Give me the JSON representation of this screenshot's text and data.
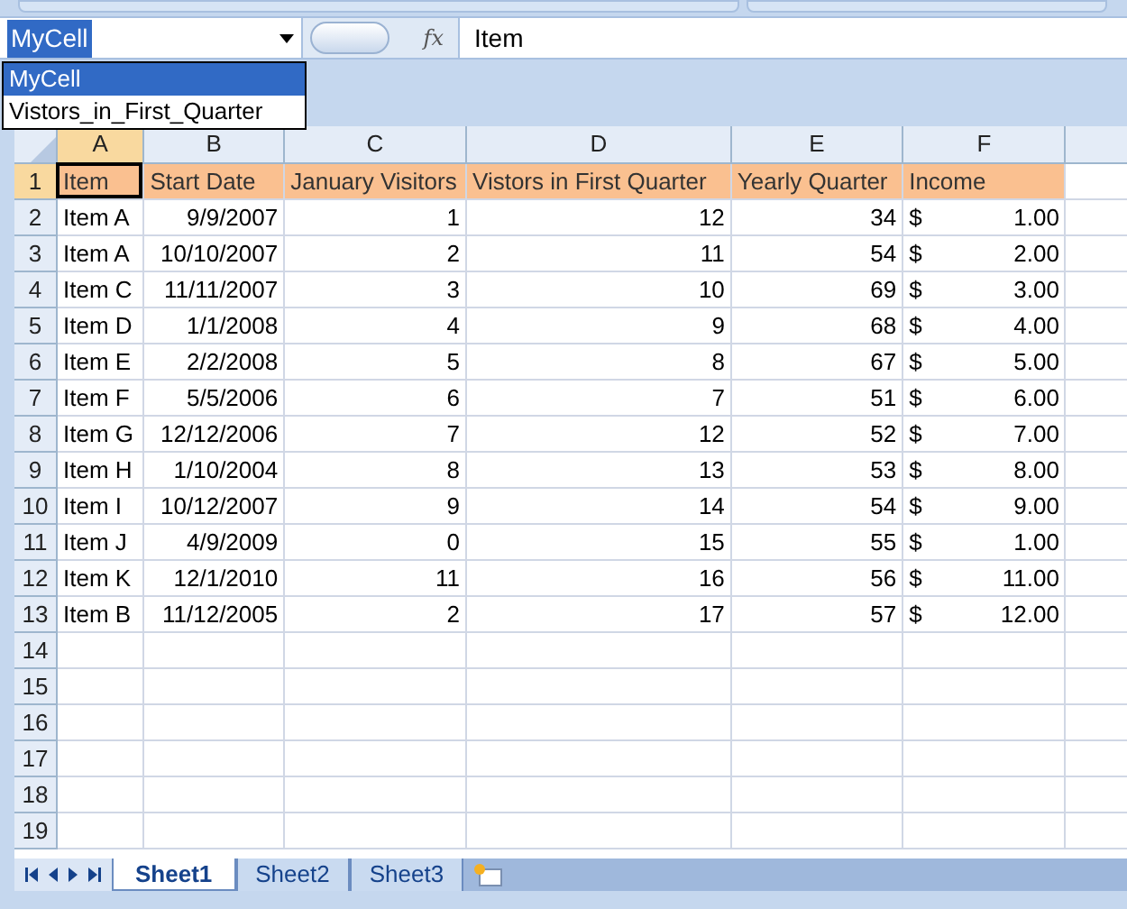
{
  "name_box": {
    "value": "MyCell"
  },
  "name_list": [
    {
      "label": "MyCell",
      "selected": true
    },
    {
      "label": "Vistors_in_First_Quarter",
      "selected": false
    }
  ],
  "formula_bar": {
    "function_label": "fx",
    "value": "Item"
  },
  "columns": [
    {
      "letter": "A",
      "kind": "text",
      "selected": true
    },
    {
      "letter": "B",
      "kind": "date",
      "selected": false
    },
    {
      "letter": "C",
      "kind": "number",
      "selected": false
    },
    {
      "letter": "D",
      "kind": "number",
      "selected": false
    },
    {
      "letter": "E",
      "kind": "number",
      "selected": false
    },
    {
      "letter": "F",
      "kind": "currency",
      "selected": false
    }
  ],
  "rows": [
    {
      "number": "1",
      "selected": true,
      "kind": "header",
      "cells": [
        "Item",
        "Start Date",
        "January Visitors",
        "Vistors in First Quarter",
        "Yearly Quarter",
        "Income"
      ]
    },
    {
      "number": "2",
      "selected": false,
      "kind": "data",
      "cells": [
        "Item A",
        "9/9/2007",
        "1",
        "12",
        "34",
        [
          "$",
          "1.00"
        ]
      ]
    },
    {
      "number": "3",
      "selected": false,
      "kind": "data",
      "cells": [
        "Item A",
        "10/10/2007",
        "2",
        "11",
        "54",
        [
          "$",
          "2.00"
        ]
      ]
    },
    {
      "number": "4",
      "selected": false,
      "kind": "data",
      "cells": [
        "Item C",
        "11/11/2007",
        "3",
        "10",
        "69",
        [
          "$",
          "3.00"
        ]
      ]
    },
    {
      "number": "5",
      "selected": false,
      "kind": "data",
      "cells": [
        "Item D",
        "1/1/2008",
        "4",
        "9",
        "68",
        [
          "$",
          "4.00"
        ]
      ]
    },
    {
      "number": "6",
      "selected": false,
      "kind": "data",
      "cells": [
        "Item E",
        "2/2/2008",
        "5",
        "8",
        "67",
        [
          "$",
          "5.00"
        ]
      ]
    },
    {
      "number": "7",
      "selected": false,
      "kind": "data",
      "cells": [
        "Item F",
        "5/5/2006",
        "6",
        "7",
        "51",
        [
          "$",
          "6.00"
        ]
      ]
    },
    {
      "number": "8",
      "selected": false,
      "kind": "data",
      "cells": [
        "Item G",
        "12/12/2006",
        "7",
        "12",
        "52",
        [
          "$",
          "7.00"
        ]
      ]
    },
    {
      "number": "9",
      "selected": false,
      "kind": "data",
      "cells": [
        "Item H",
        "1/10/2004",
        "8",
        "13",
        "53",
        [
          "$",
          "8.00"
        ]
      ]
    },
    {
      "number": "10",
      "selected": false,
      "kind": "data",
      "cells": [
        "Item I",
        "10/12/2007",
        "9",
        "14",
        "54",
        [
          "$",
          "9.00"
        ]
      ]
    },
    {
      "number": "11",
      "selected": false,
      "kind": "data",
      "cells": [
        "Item J",
        "4/9/2009",
        "0",
        "15",
        "55",
        [
          "$",
          "1.00"
        ]
      ]
    },
    {
      "number": "12",
      "selected": false,
      "kind": "data",
      "cells": [
        "Item K",
        "12/1/2010",
        "11",
        "16",
        "56",
        [
          "$",
          "11.00"
        ]
      ]
    },
    {
      "number": "13",
      "selected": false,
      "kind": "data",
      "cells": [
        "Item B",
        "11/12/2005",
        "2",
        "17",
        "57",
        [
          "$",
          "12.00"
        ]
      ]
    },
    {
      "number": "14",
      "selected": false,
      "kind": "empty",
      "cells": []
    },
    {
      "number": "15",
      "selected": false,
      "kind": "empty",
      "cells": []
    },
    {
      "number": "16",
      "selected": false,
      "kind": "empty",
      "cells": []
    },
    {
      "number": "17",
      "selected": false,
      "kind": "empty",
      "cells": []
    },
    {
      "number": "18",
      "selected": false,
      "kind": "empty",
      "cells": []
    },
    {
      "number": "19",
      "selected": false,
      "kind": "empty",
      "cells": []
    }
  ],
  "sheet_tabs": [
    {
      "label": "Sheet1",
      "selected": true
    },
    {
      "label": "Sheet2",
      "selected": false
    },
    {
      "label": "Sheet3",
      "selected": false
    }
  ]
}
